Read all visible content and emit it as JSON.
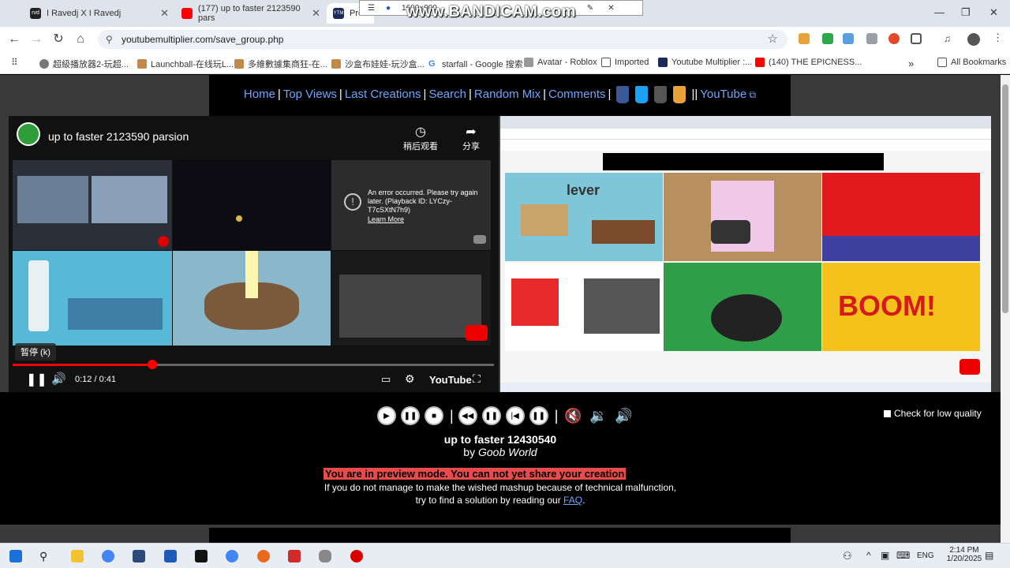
{
  "browser": {
    "tabs": [
      {
        "title": "I Ravedj X I Ravedj",
        "active": false
      },
      {
        "title": "(177) up to faster 2123590 pars",
        "active": false
      },
      {
        "title": "Prev",
        "active": true
      }
    ],
    "bandicam_size": "1600×900",
    "bandicam_watermark": "www.BANDICAM.com",
    "url": "youtubemultiplier.com/save_group.php",
    "bookmarks": [
      "超級播放器2-玩超...",
      "Launchball-在线玩L...",
      "多維數據集商狂-在...",
      "沙盒布娃娃-玩沙盒...",
      "starfall - Google 搜索",
      "Avatar - Roblox",
      "Imported",
      "Youtube Multiplier :...",
      "(140) THE EPICNESS..."
    ],
    "all_bookmarks": "All Bookmarks",
    "more_bookmarks": "»"
  },
  "site": {
    "nav": [
      "Home",
      "Top Views",
      "Last Creations",
      "Search",
      "Random Mix",
      "Comments"
    ],
    "nav_youtube": "YouTube",
    "nav_separator": "|",
    "nav_double_separator": "||"
  },
  "left_video": {
    "title": "up to faster 2123590 parsion",
    "watch_later": "稍后观看",
    "share": "分享",
    "error_text": "An error occurred. Please try again later. (Playback ID: LYCzy-T7cSXtN7h9)",
    "error_link": "Learn More",
    "pause_tooltip": "暂停 (k)",
    "time": "0:12 / 0:41",
    "progress": 0.29,
    "youtube_logo": "YouTube"
  },
  "right_video": {
    "boom_text": "BOOM!",
    "lever_text": "lever"
  },
  "player": {
    "low_quality_label": "Check for low quality",
    "creation_title": "up to faster 12430540",
    "by_prefix": "by",
    "author": "Goob World",
    "preview_warning": "You are in preview mode. You can not yet share your creation",
    "info_line1": "If you do not manage to make the wished mashup because of technical malfunction,",
    "info_line2_prefix": "try to find a solution by reading our",
    "faq_link": "FAQ",
    "info_line2_suffix": "."
  },
  "taskbar": {
    "lang": "ENG",
    "time": "2:14 PM",
    "date": "1/20/2025"
  },
  "colors": {
    "link": "#6ea6ff",
    "warn_bg": "#e84b4b",
    "progress": "#ff0000"
  }
}
